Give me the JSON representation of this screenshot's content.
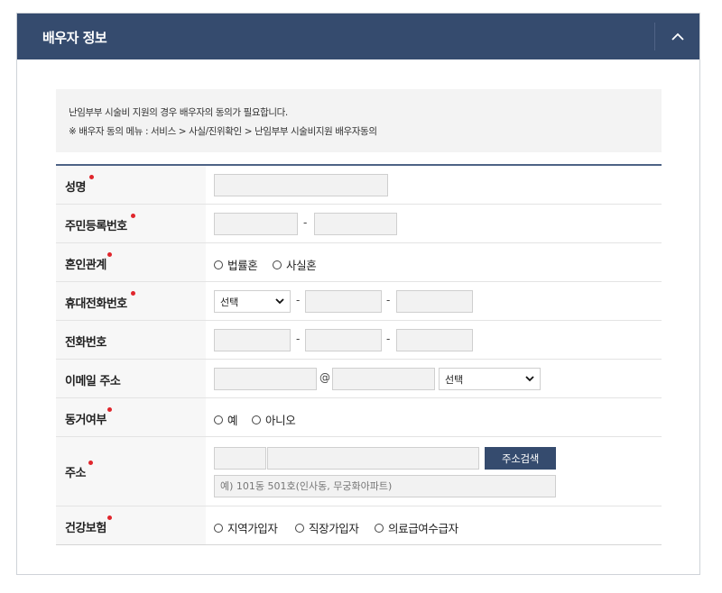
{
  "section": {
    "title": "배우자 정보"
  },
  "notice": {
    "line1": "난임부부 시술비 지원의 경우 배우자의 동의가 필요합니다.",
    "line2": "※ 배우자 동의 메뉴 : 서비스 > 사실/진위확인 > 난임부부 시술비지원 배우자동의"
  },
  "fields": {
    "name": {
      "label": "성명"
    },
    "rrn": {
      "label": "주민등록번호",
      "separator": "-"
    },
    "marriage": {
      "label": "혼인관계",
      "options": [
        "법률혼",
        "사실혼"
      ]
    },
    "mobile": {
      "label": "휴대전화번호",
      "select_value": "선택",
      "separator": "-"
    },
    "phone": {
      "label": "전화번호",
      "separator": "-"
    },
    "email": {
      "label": "이메일 주소",
      "at": "@",
      "select_value": "선택"
    },
    "cohabit": {
      "label": "동거여부",
      "options": [
        "예",
        "아니오"
      ]
    },
    "address": {
      "label": "주소",
      "search_button": "주소검색",
      "detail_placeholder": "예) 101동 501호(인사동, 무궁화아파트)"
    },
    "insurance": {
      "label": "건강보험",
      "options": [
        "지역가입자",
        "직장가입자",
        "의료급여수급자"
      ]
    }
  },
  "colors": {
    "header_bg": "#354b6e",
    "required_dot": "#e0262c",
    "label_bg": "#f7f7f7"
  }
}
